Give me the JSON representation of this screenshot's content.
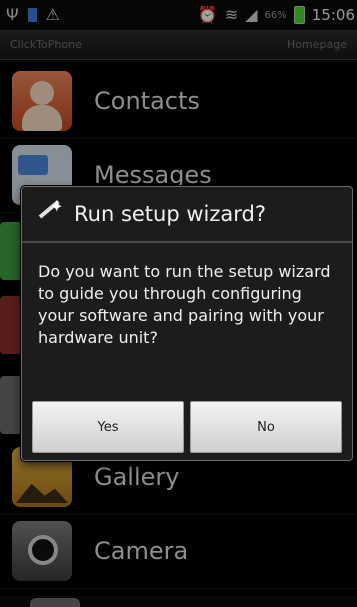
{
  "status_bar": {
    "icons": [
      "usb-icon",
      "battery-small-icon",
      "warning-icon",
      "alarm-icon",
      "wifi-icon",
      "signal-icon",
      "battery-icon"
    ],
    "battery_percent": "66%",
    "time": "15:06"
  },
  "title_bar": {
    "left": "ClickToPhone",
    "right": "Homepage"
  },
  "list": {
    "items": [
      {
        "label": "Contacts",
        "icon": "contacts-icon"
      },
      {
        "label": "Messages",
        "icon": "messages-icon"
      },
      {
        "label": "Gallery",
        "icon": "gallery-icon"
      },
      {
        "label": "Camera",
        "icon": "camera-icon"
      }
    ]
  },
  "dialog": {
    "icon": "magic-wand-icon",
    "title": "Run setup wizard?",
    "message": "Do you want to run the setup wizard to guide you through configuring your software and pairing with your hardware unit?",
    "yes_label": "Yes",
    "no_label": "No"
  }
}
